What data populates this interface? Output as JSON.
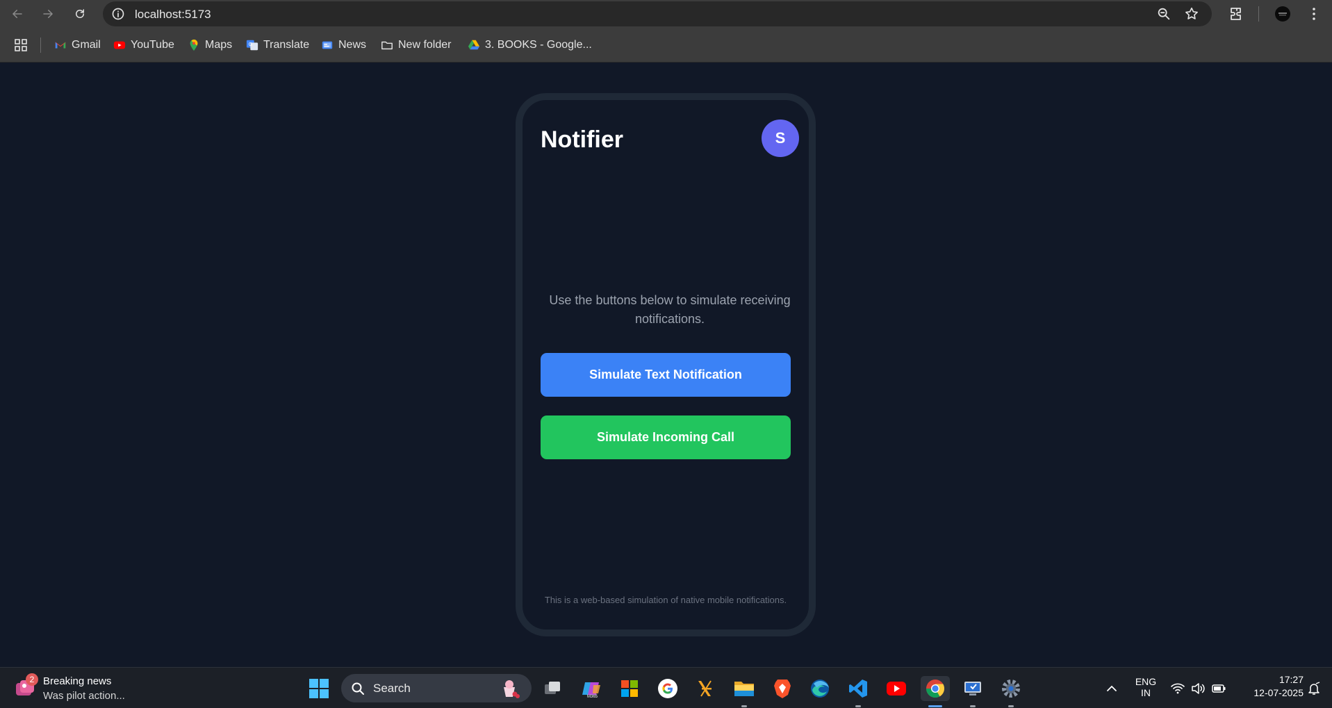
{
  "browser": {
    "url": "localhost:5173",
    "bookmarks": [
      {
        "label": "Gmail",
        "icon": "gmail-icon"
      },
      {
        "label": "YouTube",
        "icon": "youtube-icon"
      },
      {
        "label": "Maps",
        "icon": "maps-icon"
      },
      {
        "label": "Translate",
        "icon": "translate-icon"
      },
      {
        "label": "News",
        "icon": "news-icon"
      },
      {
        "label": "New folder",
        "icon": "folder-icon"
      },
      {
        "label": "3. BOOKS - Google...",
        "icon": "google-drive-icon"
      }
    ]
  },
  "app": {
    "title": "Notifier",
    "avatar_initial": "S",
    "intro_text": "Use the buttons below to simulate receiving notifications.",
    "buttons": {
      "text_notification": "Simulate Text Notification",
      "incoming_call": "Simulate Incoming Call"
    },
    "footnote": "This is a web-based simulation of native mobile notifications.",
    "colors": {
      "background": "#111827",
      "phone_frame": "#1f2937",
      "avatar": "#6366f1",
      "text_button": "#3b82f6",
      "call_button": "#22c55e"
    }
  },
  "taskbar": {
    "news": {
      "badge": "2",
      "title": "Breaking news",
      "subtitle": "Was pilot action..."
    },
    "search_placeholder": "Search",
    "apps": [
      "task-view",
      "m365-copilot",
      "microsoft-store",
      "google",
      "code-editor",
      "file-explorer",
      "brave",
      "edge",
      "vscode",
      "youtube",
      "chrome",
      "remote-desktop",
      "settings"
    ],
    "language": {
      "line1": "ENG",
      "line2": "IN"
    },
    "clock": {
      "time": "17:27",
      "date": "12-07-2025"
    }
  }
}
